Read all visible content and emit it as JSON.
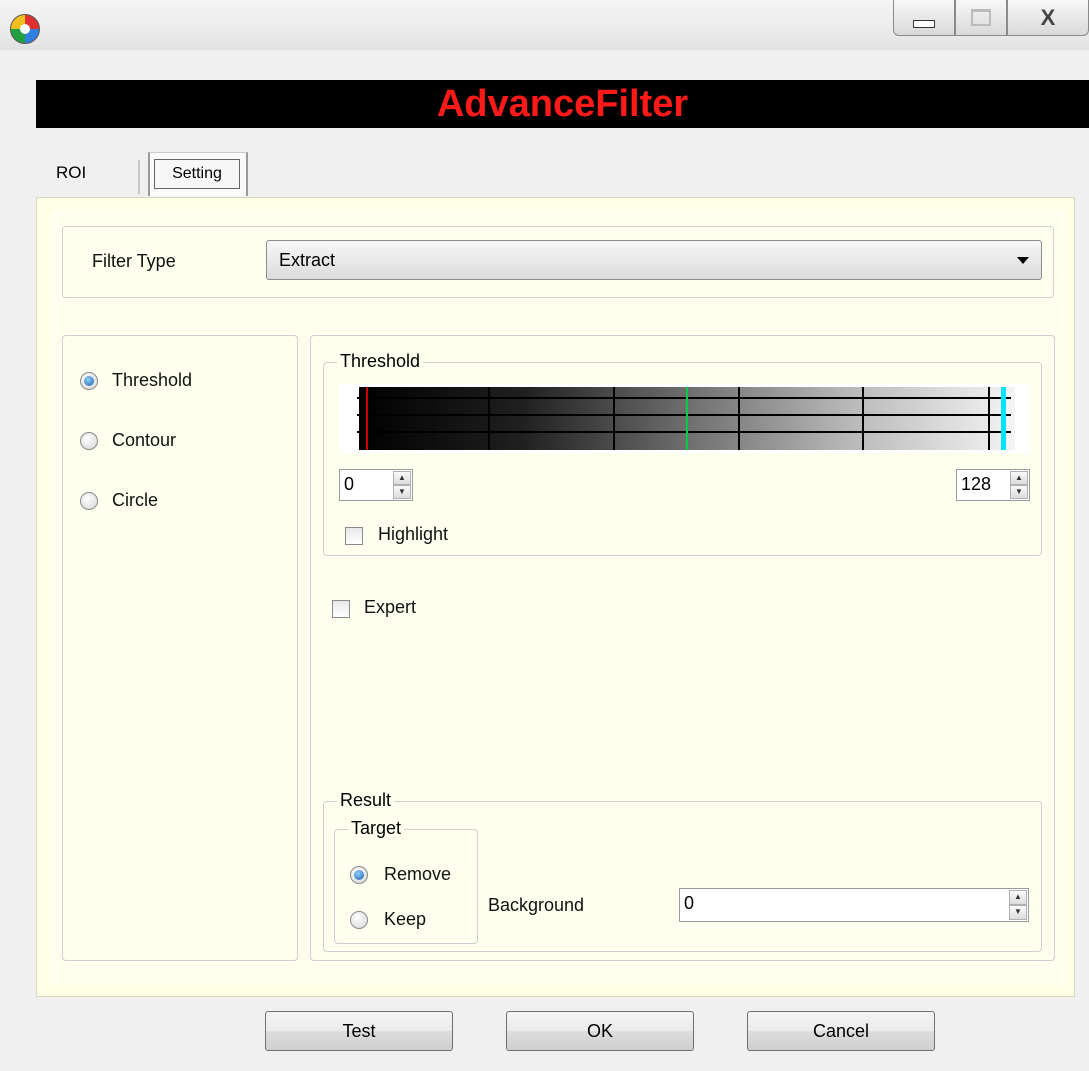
{
  "window": {
    "title": "",
    "close_glyph": "X"
  },
  "banner": {
    "title": "AdvanceFilter"
  },
  "tabs": [
    {
      "label": "ROI"
    },
    {
      "label": "Setting"
    }
  ],
  "filter_type": {
    "label": "Filter Type",
    "selected": "Extract"
  },
  "modes": [
    {
      "label": "Threshold",
      "checked": true
    },
    {
      "label": "Contour",
      "checked": false
    },
    {
      "label": "Circle",
      "checked": false
    }
  ],
  "threshold": {
    "group_label": "Threshold",
    "low_value": "0",
    "high_value": "128",
    "highlight_label": "Highlight",
    "marker_colors": {
      "low": "#cc0000",
      "mid": "#00cc44",
      "high": "#00e5ff"
    }
  },
  "expert": {
    "label": "Expert",
    "checked": false
  },
  "result": {
    "group_label": "Result",
    "target_label": "Target",
    "remove_label": "Remove",
    "keep_label": "Keep",
    "background_label": "Background",
    "background_value": "0"
  },
  "buttons": {
    "test": "Test",
    "ok": "OK",
    "cancel": "Cancel"
  }
}
